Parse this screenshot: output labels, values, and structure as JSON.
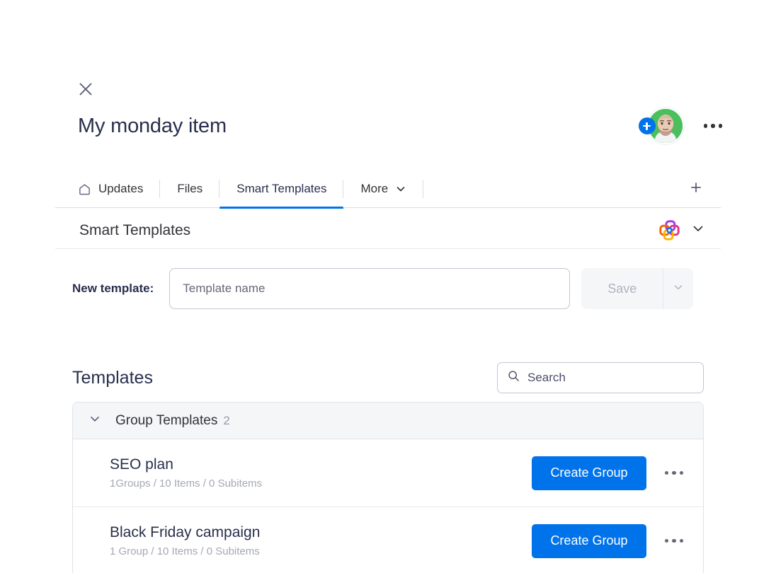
{
  "window": {
    "close_icon": "close-icon"
  },
  "header": {
    "title": "My monday item",
    "avatar_bg": "#4bbf5d",
    "add_person_icon": "plus-icon",
    "more_menu_icon": "three-dots-icon"
  },
  "tabbar": {
    "tabs": [
      {
        "label": "Updates",
        "icon": "home-icon",
        "active": false
      },
      {
        "label": "Files",
        "icon": "",
        "active": false
      },
      {
        "label": "Smart Templates",
        "icon": "",
        "active": true
      },
      {
        "label": "More",
        "icon": "chevron-down-icon",
        "active": false
      }
    ],
    "add_tab_icon": "plus-icon",
    "active_color": "#0073ea"
  },
  "section": {
    "title": "Smart Templates",
    "app_logo_icon": "smart-templates-app-logo",
    "collapse_icon": "chevron-down-icon"
  },
  "new_template": {
    "label": "New template:",
    "input_value": "",
    "input_placeholder": "Template name",
    "save_label": "Save",
    "save_disabled": true,
    "save_dropdown_icon": "chevron-down-icon"
  },
  "templates": {
    "title": "Templates",
    "search": {
      "value": "",
      "placeholder": "Search",
      "icon": "search-icon"
    },
    "groups": [
      {
        "name": "Group Templates",
        "count": "2",
        "expanded": true,
        "collapse_icon": "chevron-down-icon",
        "rows": [
          {
            "name": "SEO plan",
            "meta": "1Groups / 10 Items / 0 Subitems",
            "action_label": "Create Group",
            "menu_icon": "three-dots-icon"
          },
          {
            "name": "Black Friday campaign",
            "meta": "1 Group / 10 Items /  0 Subitems",
            "action_label": "Create Group",
            "menu_icon": "three-dots-icon"
          }
        ]
      }
    ]
  },
  "colors": {
    "accent": "#0073ea",
    "text": "#292f4c",
    "muted": "#a5a8b5",
    "group_bg": "#f5f6f8"
  }
}
